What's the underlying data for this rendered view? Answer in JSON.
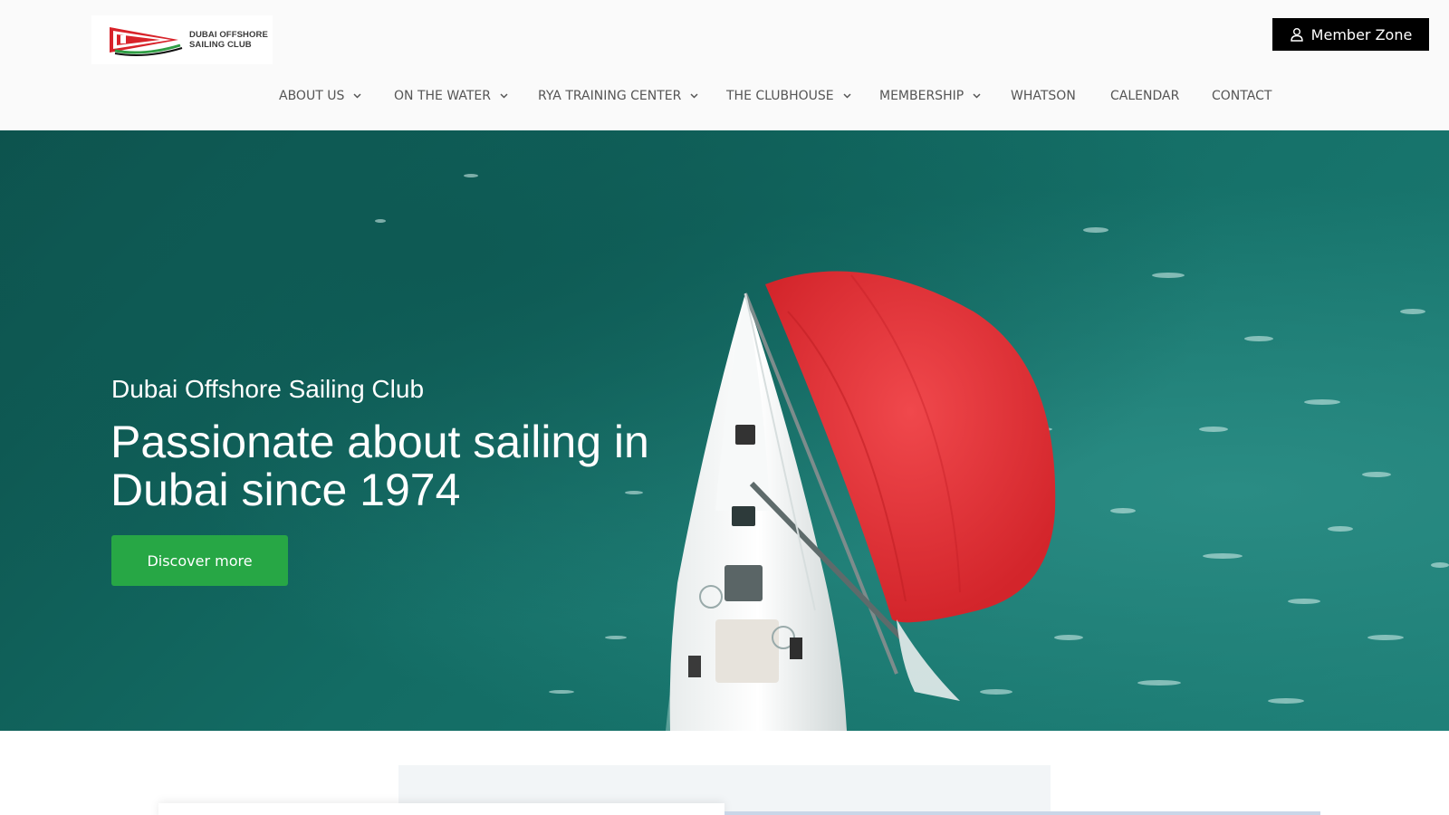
{
  "header": {
    "logo_alt": "DUBAI OFFSHORE SAILING CLUB",
    "logo_line1": "DUBAI OFFSHORE",
    "logo_line2": "SAILING CLUB",
    "member_zone_label": "Member Zone"
  },
  "nav": {
    "items": [
      {
        "label": "ABOUT US",
        "has_dropdown": true
      },
      {
        "label": "ON THE WATER",
        "has_dropdown": true
      },
      {
        "label": "RYA TRAINING CENTER",
        "has_dropdown": true
      },
      {
        "label": "THE CLUBHOUSE",
        "has_dropdown": true
      },
      {
        "label": "MEMBERSHIP",
        "has_dropdown": true
      },
      {
        "label": "WHATSON",
        "has_dropdown": false
      },
      {
        "label": "CALENDAR",
        "has_dropdown": false
      },
      {
        "label": "CONTACT",
        "has_dropdown": false
      }
    ]
  },
  "hero": {
    "subtitle": "Dubai Offshore Sailing Club",
    "title": "Passionate about sailing in Dubai since 1974",
    "cta_label": "Discover more",
    "image": "aerial sailboat with red spinnaker on turquoise sea"
  },
  "colors": {
    "cta_green": "#27a745",
    "member_button": "#000000",
    "sea": "#136c64",
    "spinnaker": "#e8353b"
  },
  "icons": {
    "member": "user-icon",
    "dropdown": "chevron-down-icon"
  }
}
